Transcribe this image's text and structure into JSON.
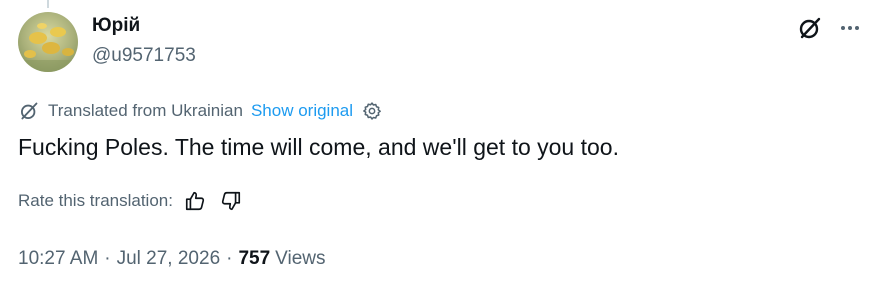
{
  "author": {
    "display_name": "Юрій",
    "handle": "@u9571753",
    "avatar_icon": "dandelion-field-avatar"
  },
  "header_actions": {
    "grok_icon": "grok-icon",
    "more_icon": "more-horizontal-icon"
  },
  "translation": {
    "icon": "grok-icon",
    "translated_from": "Translated from Ukrainian",
    "show_original": "Show original",
    "settings_icon": "gear-icon"
  },
  "tweet": {
    "text": "Fucking Poles. The time will come, and we'll get to you too."
  },
  "rating": {
    "label": "Rate this translation:",
    "thumbs_up_icon": "thumbs-up-icon",
    "thumbs_down_icon": "thumbs-down-icon"
  },
  "meta": {
    "time": "10:27 AM",
    "separator": "·",
    "date": "Jul 27, 2026",
    "views_count": "757",
    "views_label": "Views"
  },
  "colors": {
    "text_primary": "#0f1419",
    "text_secondary": "#536471",
    "link_blue": "#1d9bf0",
    "thread_line": "#cfd9de"
  }
}
